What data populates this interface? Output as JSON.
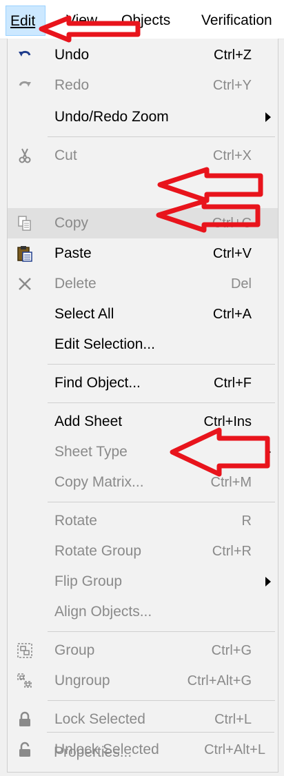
{
  "menubar": {
    "edit": "Edit",
    "view": "View",
    "objects": "Objects",
    "verification": "Verification"
  },
  "menu": {
    "undo": {
      "label": "Undo",
      "shortcut": "Ctrl+Z"
    },
    "redo": {
      "label": "Redo",
      "shortcut": "Ctrl+Y"
    },
    "undo_redo_zoom": {
      "label": "Undo/Redo Zoom"
    },
    "cut": {
      "label": "Cut",
      "shortcut": "Ctrl+X"
    },
    "copy": {
      "label": "Copy",
      "shortcut": "Ctrl+C"
    },
    "paste": {
      "label": "Paste",
      "shortcut": "Ctrl+V"
    },
    "delete": {
      "label": "Delete",
      "shortcut": "Del"
    },
    "select_all": {
      "label": "Select All",
      "shortcut": "Ctrl+A"
    },
    "edit_selection": {
      "label": "Edit Selection..."
    },
    "find_object": {
      "label": "Find Object...",
      "shortcut": "Ctrl+F"
    },
    "add_sheet": {
      "label": "Add Sheet",
      "shortcut": "Ctrl+Ins"
    },
    "sheet_type": {
      "label": "Sheet Type"
    },
    "copy_matrix": {
      "label": "Copy Matrix...",
      "shortcut": "Ctrl+M"
    },
    "rotate": {
      "label": "Rotate",
      "shortcut": "R"
    },
    "rotate_group": {
      "label": "Rotate Group",
      "shortcut": "Ctrl+R"
    },
    "flip_group": {
      "label": "Flip Group"
    },
    "align_objects": {
      "label": "Align Objects..."
    },
    "group": {
      "label": "Group",
      "shortcut": "Ctrl+G"
    },
    "ungroup": {
      "label": "Ungroup",
      "shortcut": "Ctrl+Alt+G"
    },
    "lock_selected": {
      "label": "Lock Selected",
      "shortcut": "Ctrl+L"
    },
    "unlock_selected": {
      "label": "Unlock Selected",
      "shortcut": "Ctrl+Alt+L"
    },
    "properties": {
      "label": "Properties..."
    }
  },
  "colors": {
    "annotation_red": "#e8141c",
    "disabled_text": "#8a8a8a",
    "menubar_active": "#cce8ff"
  },
  "icons": [
    "undo-icon",
    "redo-icon",
    "cut-icon",
    "copy-icon",
    "paste-icon",
    "delete-icon",
    "group-icon",
    "ungroup-icon",
    "lock-icon",
    "unlock-icon"
  ]
}
